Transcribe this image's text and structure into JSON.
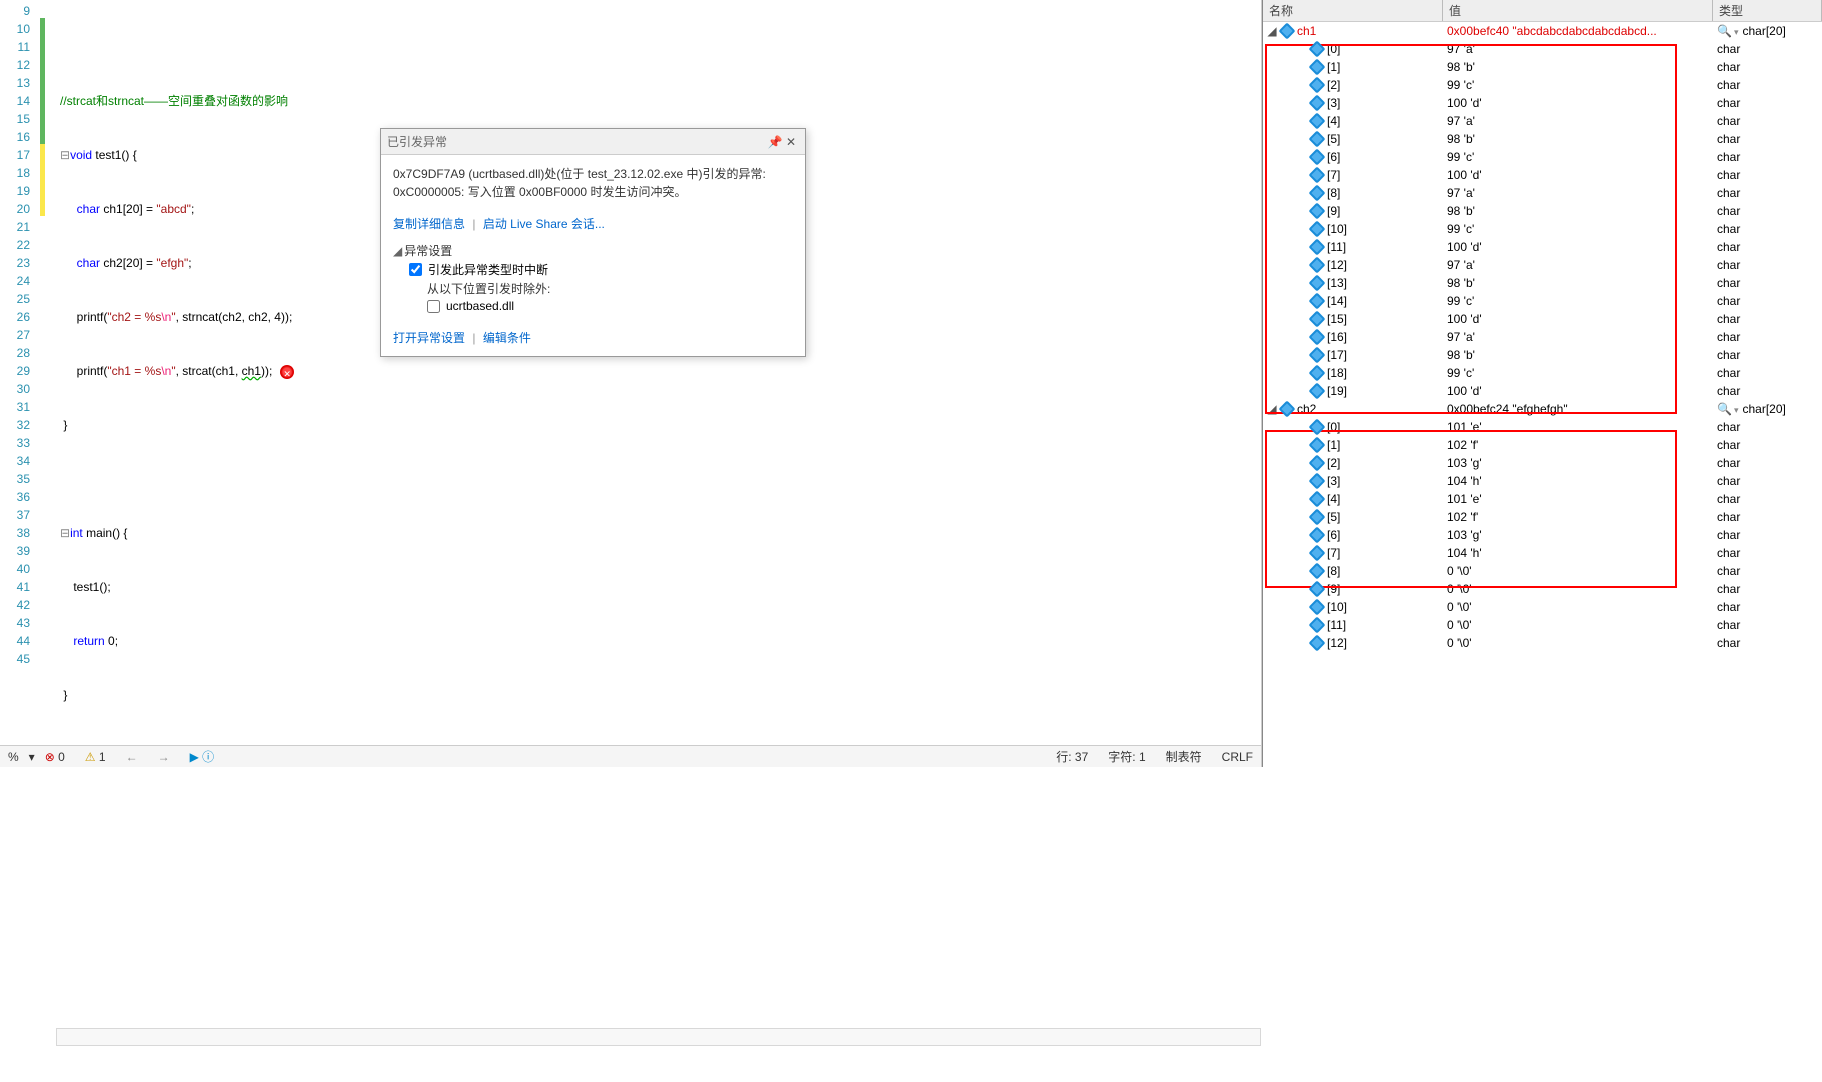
{
  "gutter": {
    "start": 9,
    "end": 45
  },
  "code": {
    "l10_comment": "//strcat和strncat——空间重叠对函数的影响",
    "l11_a": "void",
    "l11_b": " test1() {",
    "l12_a": "char",
    "l12_b": " ch1[20] = ",
    "l12_c": "\"abcd\"",
    "l12_d": ";",
    "l13_a": "char",
    "l13_b": " ch2[20] = ",
    "l13_c": "\"efgh\"",
    "l13_d": ";",
    "l14_a": "printf",
    "l14_b": "(",
    "l14_c": "\"ch2 = %s",
    "l14_d": "\\n",
    "l14_e": "\"",
    "l14_f": ", strncat(ch2, ch2, 4));",
    "l15_a": "printf",
    "l15_b": "(",
    "l15_c": "\"ch1 = %s",
    "l15_d": "\\n",
    "l15_e": "\"",
    "l15_f": ", strcat(ch1, ",
    "l15_g": "ch1",
    "l15_h": "));",
    "l16": "}",
    "l18_a": "int",
    "l18_b": " main() {",
    "l19": "    test1();",
    "l20_a": "    return",
    "l20_b": " 0;",
    "l21": "}"
  },
  "exception": {
    "title": "已引发异常",
    "msg1": "0x7C9DF7A9 (ucrtbased.dll)处(位于 test_23.12.02.exe 中)引发的异常: 0xC0000005: 写入位置 0x00BF0000 时发生访问冲突。",
    "link1": "复制详细信息",
    "link2": "启动 Live Share 会话...",
    "settings_hdr": "异常设置",
    "cb1": "引发此异常类型时中断",
    "sub1": "从以下位置引发时除外:",
    "cb2": "ucrtbased.dll",
    "footer1": "打开异常设置",
    "footer2": "编辑条件"
  },
  "status": {
    "pct": "%",
    "err": "0",
    "warn": "1",
    "line_lbl": "行:",
    "line": "37",
    "char_lbl": "字符:",
    "char": "1",
    "tabs": "制表符",
    "crlf": "CRLF"
  },
  "watch": {
    "hdr_name": "名称",
    "hdr_val": "值",
    "hdr_type": "类型",
    "ch1": {
      "name": "ch1",
      "val": "0x00befc40 \"abcdabcdabcdabcdabcd...",
      "type": "char[20]",
      "items": [
        {
          "idx": "[0]",
          "val": "97 'a'",
          "type": "char"
        },
        {
          "idx": "[1]",
          "val": "98 'b'",
          "type": "char"
        },
        {
          "idx": "[2]",
          "val": "99 'c'",
          "type": "char"
        },
        {
          "idx": "[3]",
          "val": "100 'd'",
          "type": "char"
        },
        {
          "idx": "[4]",
          "val": "97 'a'",
          "type": "char"
        },
        {
          "idx": "[5]",
          "val": "98 'b'",
          "type": "char"
        },
        {
          "idx": "[6]",
          "val": "99 'c'",
          "type": "char"
        },
        {
          "idx": "[7]",
          "val": "100 'd'",
          "type": "char"
        },
        {
          "idx": "[8]",
          "val": "97 'a'",
          "type": "char"
        },
        {
          "idx": "[9]",
          "val": "98 'b'",
          "type": "char"
        },
        {
          "idx": "[10]",
          "val": "99 'c'",
          "type": "char"
        },
        {
          "idx": "[11]",
          "val": "100 'd'",
          "type": "char"
        },
        {
          "idx": "[12]",
          "val": "97 'a'",
          "type": "char"
        },
        {
          "idx": "[13]",
          "val": "98 'b'",
          "type": "char"
        },
        {
          "idx": "[14]",
          "val": "99 'c'",
          "type": "char"
        },
        {
          "idx": "[15]",
          "val": "100 'd'",
          "type": "char"
        },
        {
          "idx": "[16]",
          "val": "97 'a'",
          "type": "char"
        },
        {
          "idx": "[17]",
          "val": "98 'b'",
          "type": "char"
        },
        {
          "idx": "[18]",
          "val": "99 'c'",
          "type": "char"
        },
        {
          "idx": "[19]",
          "val": "100 'd'",
          "type": "char"
        }
      ]
    },
    "ch2": {
      "name": "ch2",
      "val": "0x00befc24 \"efghefgh\"",
      "type": "char[20]",
      "items": [
        {
          "idx": "[0]",
          "val": "101 'e'",
          "type": "char"
        },
        {
          "idx": "[1]",
          "val": "102 'f'",
          "type": "char"
        },
        {
          "idx": "[2]",
          "val": "103 'g'",
          "type": "char"
        },
        {
          "idx": "[3]",
          "val": "104 'h'",
          "type": "char"
        },
        {
          "idx": "[4]",
          "val": "101 'e'",
          "type": "char"
        },
        {
          "idx": "[5]",
          "val": "102 'f'",
          "type": "char"
        },
        {
          "idx": "[6]",
          "val": "103 'g'",
          "type": "char"
        },
        {
          "idx": "[7]",
          "val": "104 'h'",
          "type": "char"
        },
        {
          "idx": "[8]",
          "val": "0 '\\0'",
          "type": "char"
        },
        {
          "idx": "[9]",
          "val": "0 '\\0'",
          "type": "char"
        },
        {
          "idx": "[10]",
          "val": "0 '\\0'",
          "type": "char"
        },
        {
          "idx": "[11]",
          "val": "0 '\\0'",
          "type": "char"
        },
        {
          "idx": "[12]",
          "val": "0 '\\0'",
          "type": "char"
        }
      ]
    }
  }
}
